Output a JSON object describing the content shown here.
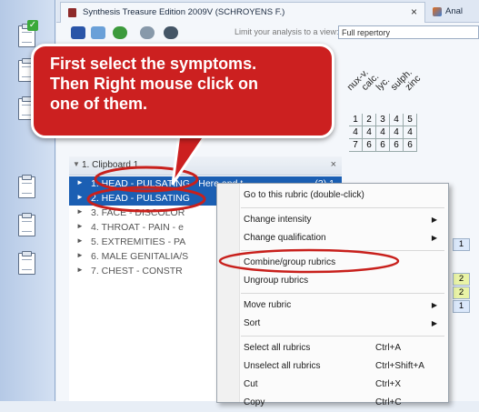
{
  "window": {
    "title": "Synthesis Treasure Edition 2009V (SCHROYENS F.)",
    "second_tab": "Anal"
  },
  "toolbar": {
    "view_label": "Limit your analysis to a view:",
    "view_value": "Full repertory"
  },
  "remedies": [
    "nux-v.",
    "calc.",
    "lyc.",
    "sulph.",
    "zinc"
  ],
  "grid": [
    [
      "1",
      "2",
      "3",
      "4",
      "5"
    ],
    [
      "4",
      "4",
      "4",
      "4",
      "4"
    ],
    [
      "7",
      "6",
      "6",
      "6",
      "6"
    ]
  ],
  "clipboard": {
    "title": "1. Clipboard 1",
    "close": "×",
    "rows": [
      {
        "label": "1. HEAD - PULSATING - Here and t",
        "count": "(3) 1",
        "selected": true
      },
      {
        "label": "2. HEAD - PULSATING",
        "count": "",
        "selected": true
      },
      {
        "label": "3. FACE - DISCOLOR",
        "count": "",
        "selected": false
      },
      {
        "label": "4. THROAT - PAIN - e",
        "count": "",
        "selected": false
      },
      {
        "label": "5. EXTREMITIES - PA",
        "count": "",
        "selected": false
      },
      {
        "label": "6. MALE GENITALIA/S",
        "count": "",
        "selected": false
      },
      {
        "label": "7. CHEST - CONSTR",
        "count": "",
        "selected": false
      }
    ]
  },
  "right_cells": [
    "1",
    "2",
    "2",
    "1"
  ],
  "context_menu": {
    "items": [
      {
        "label": "Go to this rubric (double-click)",
        "shortcut": "",
        "submenu": false
      },
      {
        "label": "Change intensity",
        "shortcut": "",
        "submenu": true
      },
      {
        "label": "Change qualification",
        "shortcut": "",
        "submenu": true
      },
      {
        "label": "Combine/group rubrics",
        "shortcut": "",
        "submenu": false
      },
      {
        "label": "Ungroup rubrics",
        "shortcut": "",
        "submenu": false
      },
      {
        "label": "Move rubric",
        "shortcut": "",
        "submenu": true
      },
      {
        "label": "Sort",
        "shortcut": "",
        "submenu": true
      },
      {
        "label": "Select all rubrics",
        "shortcut": "Ctrl+A",
        "submenu": false
      },
      {
        "label": "Unselect all rubrics",
        "shortcut": "Ctrl+Shift+A",
        "submenu": false
      },
      {
        "label": "Cut",
        "shortcut": "Ctrl+X",
        "submenu": false
      },
      {
        "label": "Copy",
        "shortcut": "Ctrl+C",
        "submenu": false
      }
    ]
  },
  "callout": {
    "text": "First select the symptoms.\nThen Right mouse click on\none of them."
  },
  "colors": {
    "callout_red": "#cc2020",
    "selection_blue": "#1b5fb3",
    "highlight_ellipse": "#c8201c"
  },
  "icons": [
    "clipboard-check-icon",
    "clipboard-icon",
    "book-icon",
    "chevron-right-icon",
    "close-icon"
  ]
}
